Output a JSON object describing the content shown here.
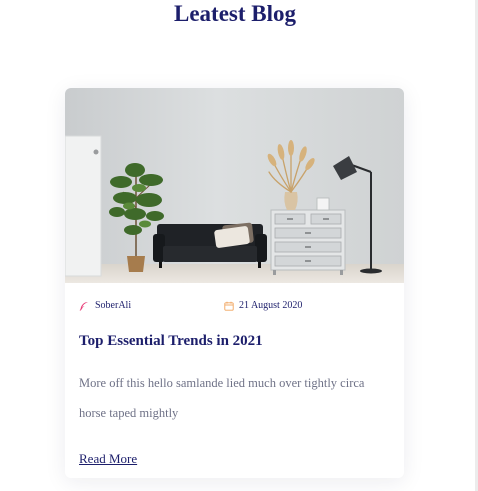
{
  "section": {
    "title": "Leatest Blog"
  },
  "card": {
    "author": "SoberAli",
    "date": "21 August 2020",
    "title": "Top Essential Trends in 2021",
    "excerpt": "More off this hello samlande lied much over tightly circa horse taped mightly",
    "read_more": "Read More",
    "image_alt": "Living room with black sofa, potted plant, white dresser and floor lamp"
  },
  "icons": {
    "author": "feather-icon",
    "date": "calendar-icon"
  },
  "colors": {
    "heading": "#1c1e6b",
    "body_text": "#6f7287",
    "author_icon": "#e8407a",
    "date_icon": "#f0a35c"
  }
}
